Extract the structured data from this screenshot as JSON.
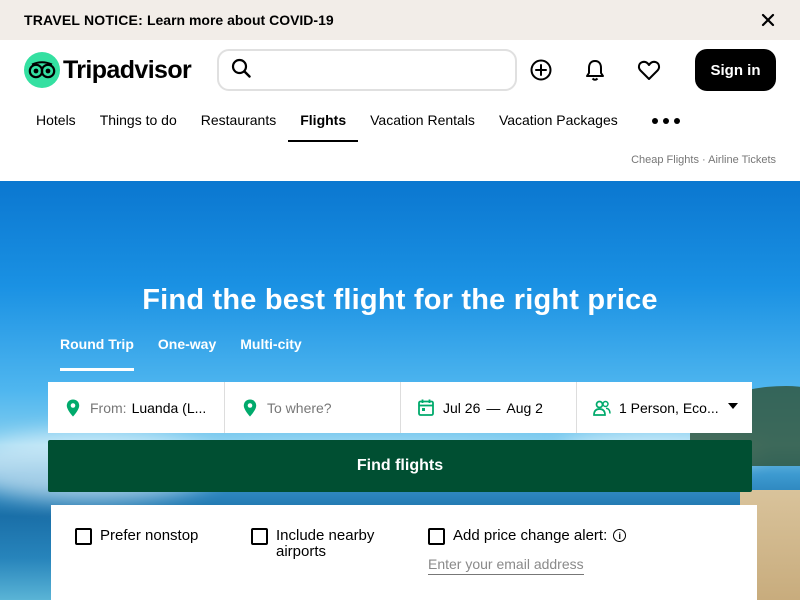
{
  "notice": {
    "label": "TRAVEL NOTICE:",
    "link": "Learn more about COVID-19"
  },
  "header": {
    "logo_text": "Tripadvisor",
    "search_placeholder": "",
    "signin_label": "Sign in"
  },
  "nav": {
    "items": [
      "Hotels",
      "Things to do",
      "Restaurants",
      "Flights",
      "Vacation Rentals",
      "Vacation Packages"
    ],
    "active": "Flights"
  },
  "sublinks": {
    "cheap_flights": "Cheap Flights",
    "separator": "·",
    "airline_tickets": "Airline Tickets"
  },
  "hero": {
    "title": "Find the best flight for the right price",
    "tabs": [
      "Round Trip",
      "One-way",
      "Multi-city"
    ],
    "active_tab": "Round Trip"
  },
  "form": {
    "from_label": "From:",
    "from_value": "Luanda (L...",
    "to_placeholder": "To where?",
    "depart": "Jul 26",
    "dash": "—",
    "return": "Aug 2",
    "passengers": "1 Person, Eco..."
  },
  "find_button": "Find flights",
  "options": {
    "nonstop": "Prefer nonstop",
    "nearby": "Include nearby airports",
    "alert": "Add price change alert:",
    "email_placeholder": "Enter your email address"
  },
  "colors": {
    "brand_green": "#34e0a1",
    "find_button": "#004f32",
    "notice_bg": "#f2ede8"
  }
}
